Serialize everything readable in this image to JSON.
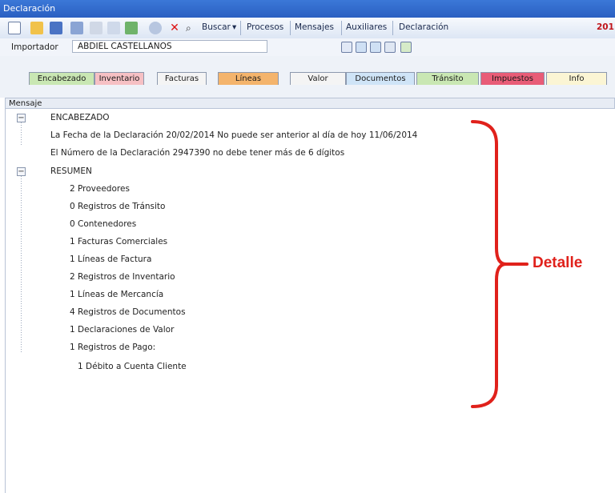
{
  "window": {
    "title": "Declaración"
  },
  "toolbar": {
    "buscar_label": "Buscar",
    "procesos_label": "Procesos",
    "mensajes_label": "Mensajes",
    "auxiliares_label": "Auxiliares",
    "declaracion_label": "Declaración",
    "year_label": "201"
  },
  "importador": {
    "label": "Importador",
    "value": "ABDIEL CASTELLANOS"
  },
  "tabs": [
    {
      "label": "Encabezado",
      "color": "#c9e7b3"
    },
    {
      "label": "Inventario",
      "color": "#f6c0c4"
    },
    {
      "label": "Facturas",
      "color": "#f4f4f4"
    },
    {
      "label": "Líneas",
      "color": "#f4b46c"
    },
    {
      "label": "Valor",
      "color": "#f4f4f4"
    },
    {
      "label": "Documentos",
      "color": "#cfe4f7"
    },
    {
      "label": "Tránsito",
      "color": "#c9e7b3"
    },
    {
      "label": "Impuestos",
      "color": "#e85c77"
    },
    {
      "label": "Info",
      "color": "#fbf5d4"
    }
  ],
  "panel": {
    "header": "Mensaje",
    "encabezado": {
      "title": "ENCABEZADO",
      "items": [
        "La Fecha de la Declaración 20/02/2014 No puede ser anterior al día de hoy 11/06/2014",
        "El Número de la Declaración 2947390 no debe tener más de 6 dígitos"
      ]
    },
    "resumen": {
      "title": "RESUMEN",
      "items": [
        "2 Proveedores",
        "0 Registros de Tránsito",
        "0 Contenedores",
        "1 Facturas Comerciales",
        "1 Líneas de Factura",
        "2 Registros de Inventario",
        "1 Líneas de Mercancía",
        "4 Registros de Documentos",
        "1 Declaraciones de Valor",
        "1 Registros de Pago:"
      ],
      "sub_item": "1 Débito a Cuenta Cliente"
    }
  },
  "annotation": {
    "label": "Detalle",
    "color": "#e0211b"
  }
}
